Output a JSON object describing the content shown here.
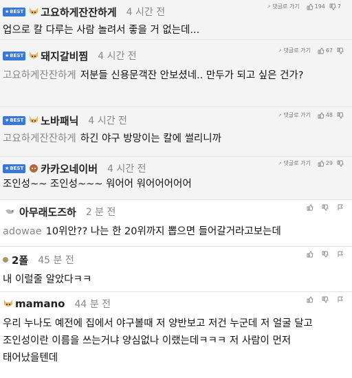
{
  "reply_label": "댓글로 가기",
  "best_label": "BEST",
  "comments": [
    {
      "nick": "고요하게잔잔하게",
      "time": "4 시간 전",
      "best": true,
      "up": "194",
      "down": "7",
      "mention": "",
      "text": "업으로 칼 다루는 사람 놀려서 좋을 거 없는데..."
    },
    {
      "nick": "돼지갈비찜",
      "time": "4 시간 전",
      "best": true,
      "up": "67",
      "down": "",
      "mention": "고요하게잔잔하게",
      "text": "저분들 신용문객잔 안보셨네.. 만두가 되고 싶은 건가?"
    },
    {
      "nick": "노바패닉",
      "time": "4 시간 전",
      "best": true,
      "up": "48",
      "down": "",
      "mention": "고요하게잔잔하게",
      "text": "하긴 야구 방망이는 칼에 썰리니까"
    },
    {
      "nick": "카카오네이버",
      "time": "4 시간 전",
      "best": true,
      "up": "29",
      "down": "",
      "mention": "",
      "text": "조인성~~ 조인성~~~ 워어어 워어어어어어"
    },
    {
      "nick": "아무래도즈하",
      "time": "2 분 전",
      "best": false,
      "mention": "adowae",
      "text": "10위안?? 나는 한 20위까지 뽑으면 들어갈거라고보는데"
    },
    {
      "nick": "2폴",
      "time": "45 분 전",
      "best": false,
      "mention": "",
      "text": "내 이럴줄 알았다ㅋㅋ"
    },
    {
      "nick": "mamano",
      "time": "44 분 전",
      "best": false,
      "mention": "",
      "text": "우리 누나도 예전에 집에서 야구볼때 저 양반보고 저건 누군데 저 얼굴 달고 조인성이란 이름을 쓰는거냐 양심없나 이랬는데ㅋㅋㅋ 저 사람이 먼저 태어났을텐데"
    }
  ]
}
